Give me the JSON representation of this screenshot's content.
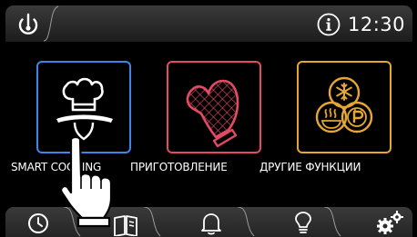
{
  "status_bar": {
    "time": "12:30",
    "icons": [
      "power-icon",
      "info-icon"
    ]
  },
  "functions": [
    {
      "label": "SMART COOKING",
      "icon": "chef-hat-tray-icon",
      "accent": "#3d86e8"
    },
    {
      "label": "ПРИГОТОВЛЕНИЕ",
      "icon": "oven-mitt-icon",
      "accent": "#e24b63"
    },
    {
      "label": "ДРУГИЕ ФУНКЦИИ",
      "icon": "other-functions-icon",
      "accent": "#e6a634"
    }
  ],
  "bottom_tabs": [
    "timer-icon",
    "recipe-book-icon",
    "bell-icon",
    "lightbulb-icon",
    "settings-gears-icon"
  ],
  "overlay": {
    "icon": "pointing-hand-icon"
  }
}
